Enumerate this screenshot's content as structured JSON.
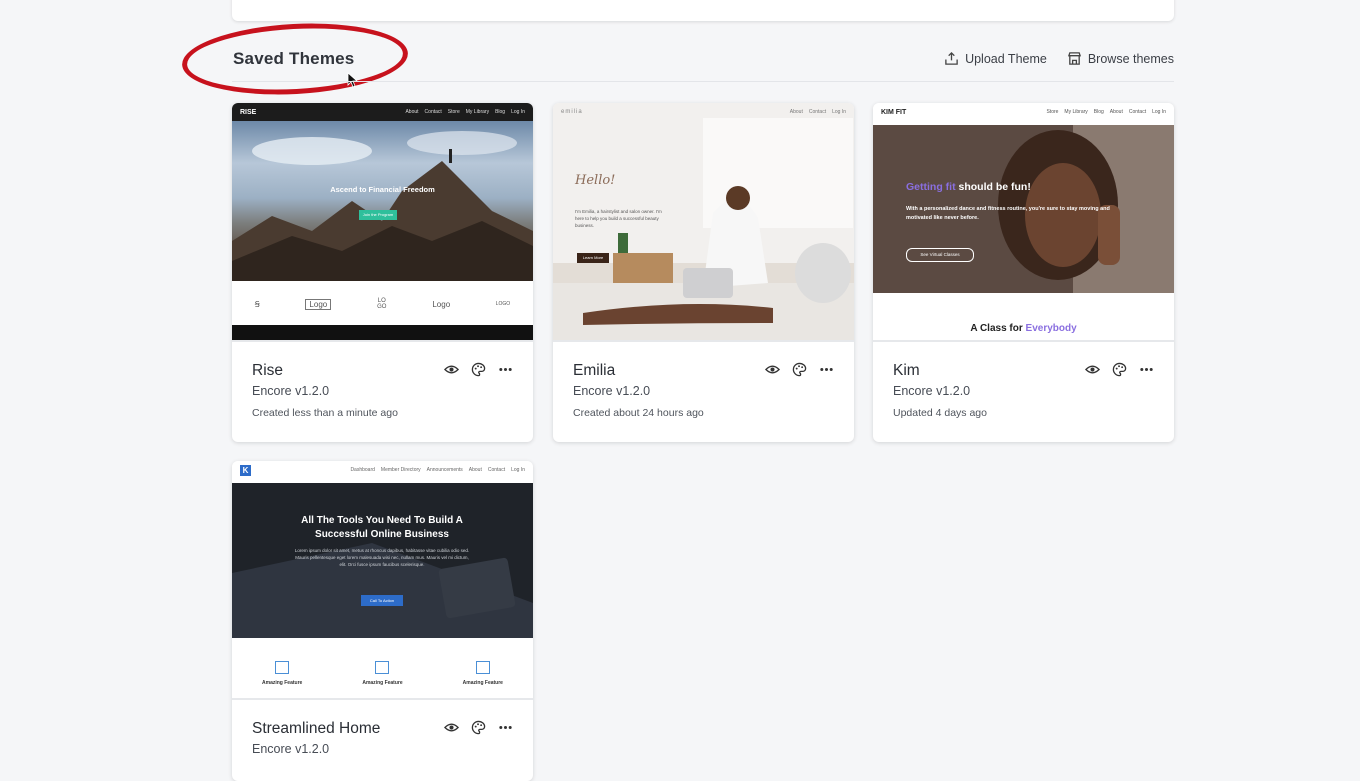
{
  "section_title": "Saved Themes",
  "actions": {
    "upload": "Upload Theme",
    "browse": "Browse themes"
  },
  "themes": [
    {
      "name": "Rise",
      "version": "Encore v1.2.0",
      "meta": "Created less than a minute ago",
      "thumb": {
        "logo": "RISE",
        "nav": [
          "About",
          "Contact",
          "Store",
          "My Library",
          "Blog",
          "Log In"
        ],
        "headline": "Ascend to Financial Freedom",
        "cta": "Join the Program",
        "logos": [
          "Ꞩ",
          "Logo",
          "LO GO",
          "Logo",
          "LOGO"
        ]
      }
    },
    {
      "name": "Emilia",
      "version": "Encore v1.2.0",
      "meta": "Created about 24 hours ago",
      "thumb": {
        "logo": "emilia",
        "nav": [
          "About",
          "Contact",
          "Log In"
        ],
        "headline": "Hello!",
        "body": "I'm Emilia, a hairstylist and salon owner. I'm here to help you build a successful beauty business.",
        "cta": "Learn More"
      }
    },
    {
      "name": "Kim",
      "version": "Encore v1.2.0",
      "meta": "Updated 4 days ago",
      "thumb": {
        "logo": "KIM FIT",
        "nav": [
          "Store",
          "My Library",
          "Blog",
          "About",
          "Contact",
          "Log In"
        ],
        "headline_a": "Getting fit",
        "headline_b": " should be fun!",
        "body": "With a personalized dance and fitness routine, you're sure to stay moving and motivated like never before.",
        "cta": "See Virtual Classes",
        "footer_a": "A Class for ",
        "footer_b": "Everybody"
      }
    },
    {
      "name": "Streamlined Home",
      "version": "Encore v1.2.0",
      "thumb": {
        "logo": "K",
        "nav": [
          "Dashboard",
          "Member Directory",
          "Announcements",
          "About",
          "Contact",
          "Log In"
        ],
        "headline": "All The Tools You Need To Build A Successful Online Business",
        "body": "Lorem ipsum dolor sit amet, metus at rhoncus dapibus, habitasse vitae cubilia odio sed. Mauris pellentesque eget lorem malesuada wisi nec, nullam mus. Mauris vel mi dictum, elit. Orci fusce ipsum faucibus scelerisque.",
        "cta": "Call To Action",
        "features": [
          "Amazing Feature",
          "Amazing Feature",
          "Amazing Feature"
        ]
      }
    }
  ],
  "colors": {
    "highlight_circle": "#c7121d",
    "accent_blue": "#3b6fd6",
    "kim_purple": "#8a6fe0",
    "rise_teal": "#2fbf9b"
  }
}
